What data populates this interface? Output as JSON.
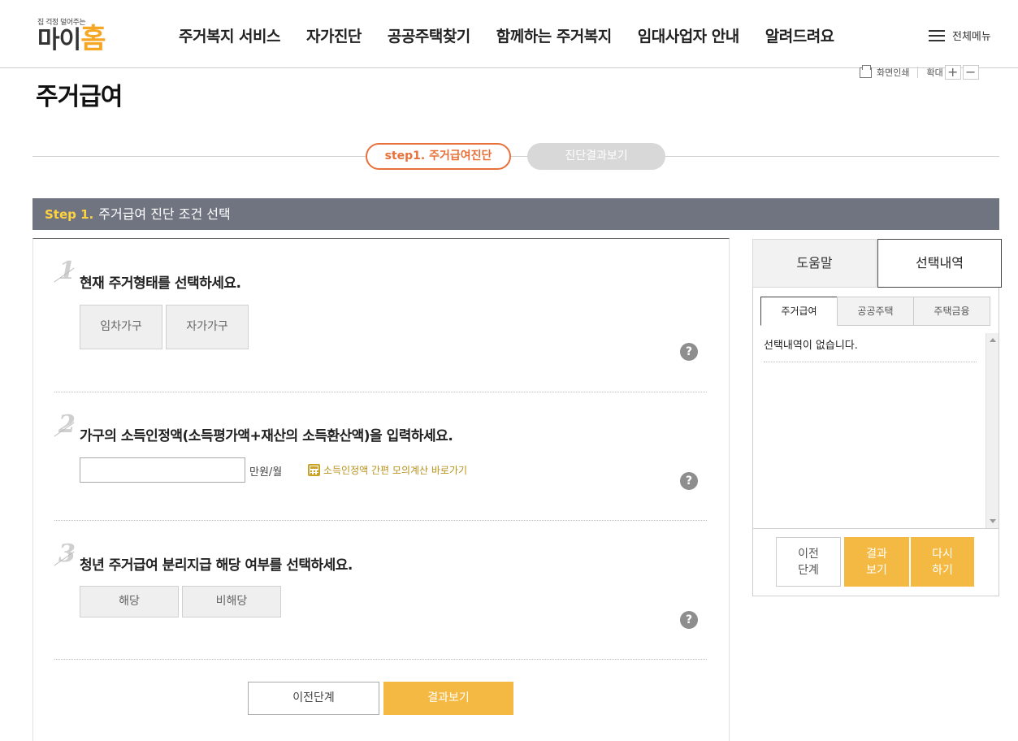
{
  "header": {
    "logo_tagline": "집 걱정 덜어주는",
    "logo_main": "마이",
    "logo_accent": "홈",
    "nav": [
      "주거복지 서비스",
      "자가진단",
      "공공주택찾기",
      "함께하는 주거복지",
      "임대사업자 안내",
      "알려드려요"
    ],
    "all_menu_label": "전체메뉴"
  },
  "utility": {
    "print_label": "화면인쇄",
    "zoom_label": "확대",
    "zoom_in": "+",
    "zoom_out": "−"
  },
  "page_title": "주거급여",
  "steps": {
    "active": "step1. 주거급여진단",
    "next": "진단결과보기"
  },
  "section": {
    "step_label": "Step 1.",
    "title": "주거급여 진단 조건 선택"
  },
  "questions": {
    "q1": {
      "num": "1",
      "title": "현재 주거형태를 선택하세요.",
      "options": [
        "임차가구",
        "자가가구"
      ]
    },
    "q2": {
      "num": "2",
      "title": "가구의 소득인정액(소득평가액+재산의 소득환산액)을 입력하세요.",
      "input_value": "",
      "unit": "만원/월",
      "calc_link": "소득인정액 간편 모의계산 바로가기"
    },
    "q3": {
      "num": "3",
      "title": "청년 주거급여 분리지급 해당 여부를 선택하세요.",
      "options": [
        "해당",
        "비해당"
      ]
    },
    "help_glyph": "?"
  },
  "buttons": {
    "prev": "이전단계",
    "result": "결과보기"
  },
  "side": {
    "tabs": [
      "도움말",
      "선택내역"
    ],
    "subtabs": [
      "주거급여",
      "공공주택",
      "주택금융"
    ],
    "empty_text": "선택내역이 없습니다.",
    "btn_prev": "이전\n단계",
    "btn_result": "결과\n보기",
    "btn_reset": "다시\n하기"
  },
  "colors": {
    "accent_orange": "#e8703a",
    "button_yellow": "#f4b942",
    "section_bar": "#6f7480",
    "step_label_yellow": "#ffd23f"
  }
}
